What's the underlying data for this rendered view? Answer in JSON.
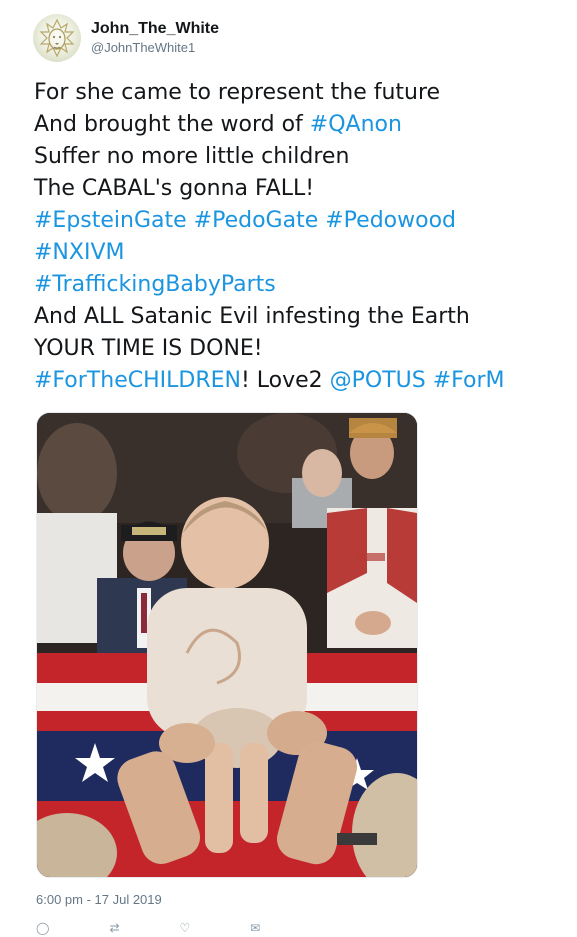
{
  "user": {
    "display_name": "John_The_White",
    "handle": "@JohnTheWhite1"
  },
  "tweet": {
    "lines": [
      [
        {
          "t": "For she came to represent the future"
        }
      ],
      [
        {
          "t": "And brought the word of "
        },
        {
          "t": "#QAnon",
          "tag": true
        }
      ],
      [
        {
          "t": "Suffer no more little children"
        }
      ],
      [
        {
          "t": "The CABAL's gonna FALL!"
        }
      ],
      [
        {
          "t": "#EpsteinGate",
          "tag": true
        },
        {
          "t": " "
        },
        {
          "t": "#PedoGate",
          "tag": true
        },
        {
          "t": " "
        },
        {
          "t": "#Pedowood",
          "tag": true
        }
      ],
      [
        {
          "t": "#NXIVM",
          "tag": true
        }
      ],
      [
        {
          "t": "#TraffickingBabyParts",
          "tag": true
        }
      ],
      [
        {
          "t": "And ALL Satanic Evil infesting the Earth"
        }
      ],
      [
        {
          "t": "YOUR TIME IS DONE!"
        }
      ],
      [
        {
          "t": "#ForTheCHILDREN",
          "tag": true
        },
        {
          "t": "! Love2 "
        },
        {
          "t": "@POTUS",
          "tag": true
        },
        {
          "t": " "
        },
        {
          "t": "#ForM",
          "tag": true
        }
      ]
    ]
  },
  "timestamp": "6:00 pm - 17 Jul 2019",
  "icons": {
    "avatar": "lion-face-drawing",
    "reply": "reply-icon",
    "retweet": "retweet-icon",
    "like": "heart-icon",
    "message": "mail-icon"
  },
  "colors": {
    "link": "#1b95e0",
    "text": "#14171a",
    "muted": "#657786"
  }
}
